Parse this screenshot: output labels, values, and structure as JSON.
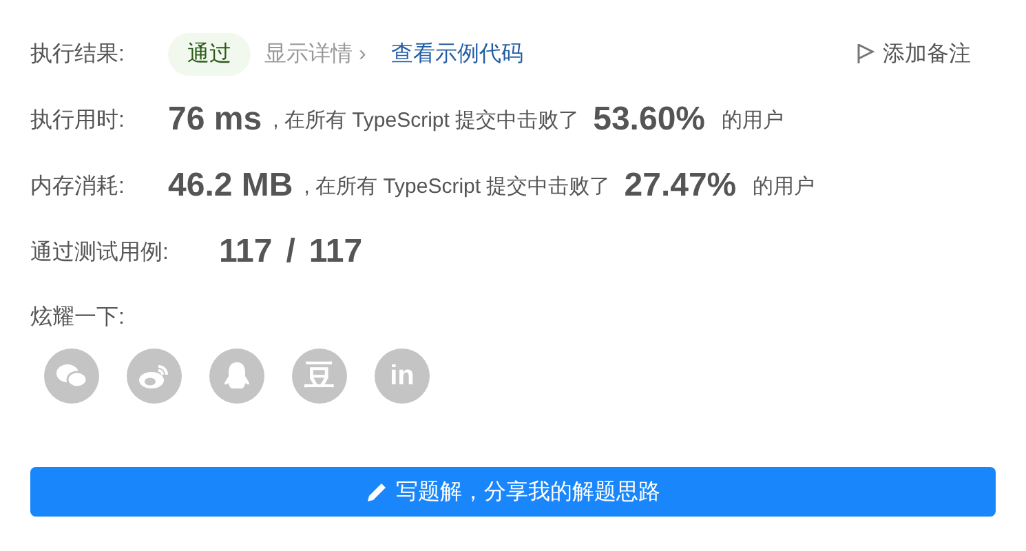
{
  "result": {
    "label": "执行结果:",
    "status": "通过",
    "details_link": "显示详情 ›",
    "example_link": "查看示例代码",
    "note_button": "添加备注"
  },
  "stats": [
    {
      "label": "执行用时:",
      "value": "76 ms",
      "middle": ", 在所有 TypeScript 提交中击败了",
      "percent": "53.60%",
      "suffix": "的用户"
    },
    {
      "label": "内存消耗:",
      "value": "46.2 MB",
      "middle": ", 在所有 TypeScript 提交中击败了",
      "percent": "27.47%",
      "suffix": "的用户"
    }
  ],
  "tests": {
    "label": "通过测试用例:",
    "passed": "117",
    "separator": "/",
    "total": "117"
  },
  "share": {
    "label": "炫耀一下:",
    "buttons": [
      {
        "kind": "wechat"
      },
      {
        "kind": "weibo"
      },
      {
        "kind": "qq"
      },
      {
        "kind": "douban",
        "glyph": "豆"
      },
      {
        "kind": "linkedin",
        "glyph": "in"
      }
    ]
  },
  "write_button": "写题解，分享我的解题思路"
}
